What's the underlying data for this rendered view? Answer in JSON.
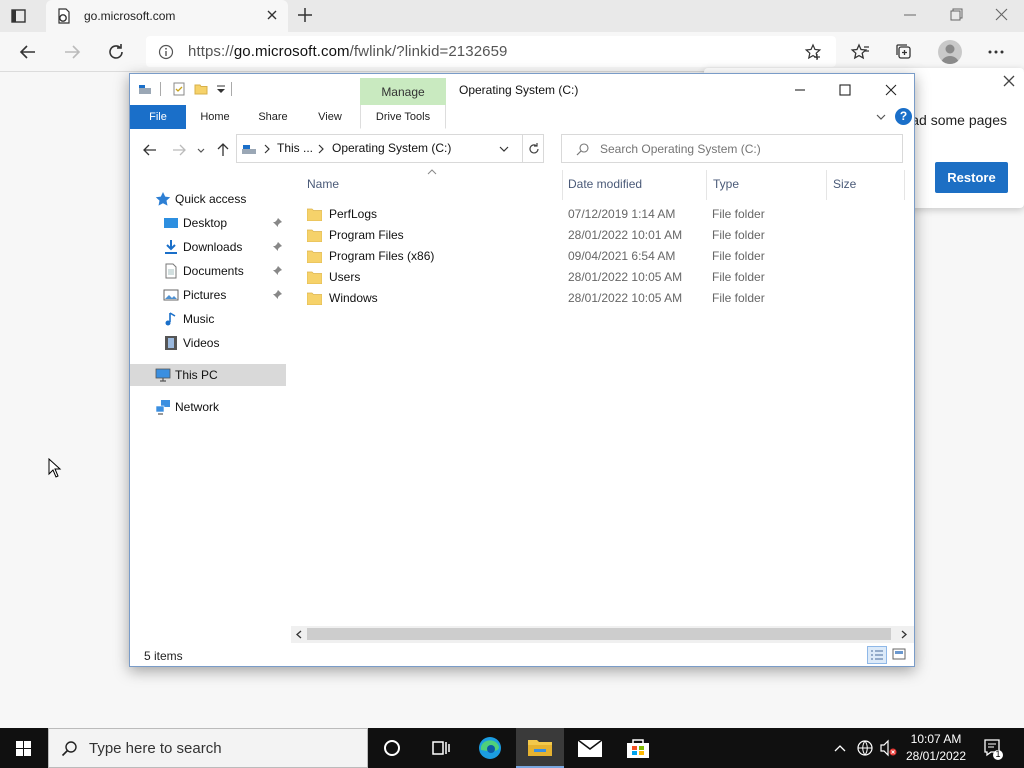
{
  "browser": {
    "tab_title": "go.microsoft.com",
    "url_prefix": "https://",
    "url_domain": "go.microsoft.com",
    "url_path": "/fwlink/?linkid=2132659"
  },
  "popup": {
    "text": "ad some pages",
    "restore_label": "Restore"
  },
  "explorer": {
    "title": "Operating System (C:)",
    "manage_tab": "Manage",
    "ribbon_tabs": [
      "File",
      "Home",
      "Share",
      "View",
      "Drive Tools"
    ],
    "breadcrumb": [
      "This ...",
      "Operating System (C:)"
    ],
    "search_placeholder": "Search Operating System (C:)",
    "nav": {
      "quick_access": "Quick access",
      "desktop": "Desktop",
      "downloads": "Downloads",
      "documents": "Documents",
      "pictures": "Pictures",
      "music": "Music",
      "videos": "Videos",
      "this_pc": "This PC",
      "network": "Network"
    },
    "columns": [
      "Name",
      "Date modified",
      "Type",
      "Size"
    ],
    "files": [
      {
        "name": "PerfLogs",
        "date": "07/12/2019 1:14 AM",
        "type": "File folder"
      },
      {
        "name": "Program Files",
        "date": "28/01/2022 10:01 AM",
        "type": "File folder"
      },
      {
        "name": "Program Files (x86)",
        "date": "09/04/2021 6:54 AM",
        "type": "File folder"
      },
      {
        "name": "Users",
        "date": "28/01/2022 10:05 AM",
        "type": "File folder"
      },
      {
        "name": "Windows",
        "date": "28/01/2022 10:05 AM",
        "type": "File folder"
      }
    ],
    "status": "5 items"
  },
  "taskbar": {
    "search_placeholder": "Type here to search",
    "time": "10:07 AM",
    "date": "28/01/2022",
    "notification_count": "1"
  },
  "colors": {
    "accent": "#1a6fc9",
    "manage_tab": "#c9eac0",
    "folder": "#f6d26a",
    "taskbar": "#101010"
  }
}
